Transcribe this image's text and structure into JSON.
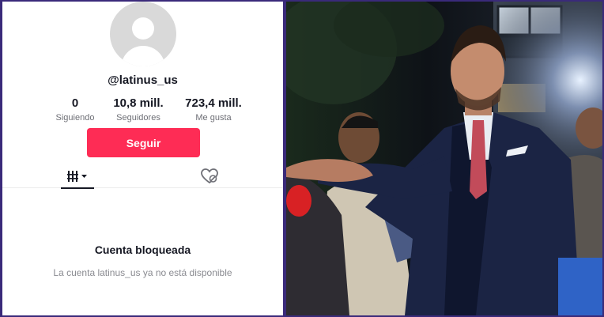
{
  "profile": {
    "username": "@latinus_us",
    "stats": [
      {
        "value": "0",
        "label": "Siguiendo"
      },
      {
        "value": "10,8 mill.",
        "label": "Seguidores"
      },
      {
        "value": "723,4 mill.",
        "label": "Me gusta"
      }
    ],
    "follow_label": "Seguir",
    "tabs": [
      {
        "icon": "videos-grid-icon",
        "active": true
      },
      {
        "icon": "liked-heart-icon",
        "active": false
      }
    ],
    "blocked_title": "Cuenta bloqueada",
    "blocked_message": "La cuenta latinus_us ya no está disponible"
  },
  "colors": {
    "follow_button": "#fe2c55",
    "frame": "#3a2a7a",
    "text_primary": "#161823",
    "text_secondary": "#8a8b91"
  }
}
